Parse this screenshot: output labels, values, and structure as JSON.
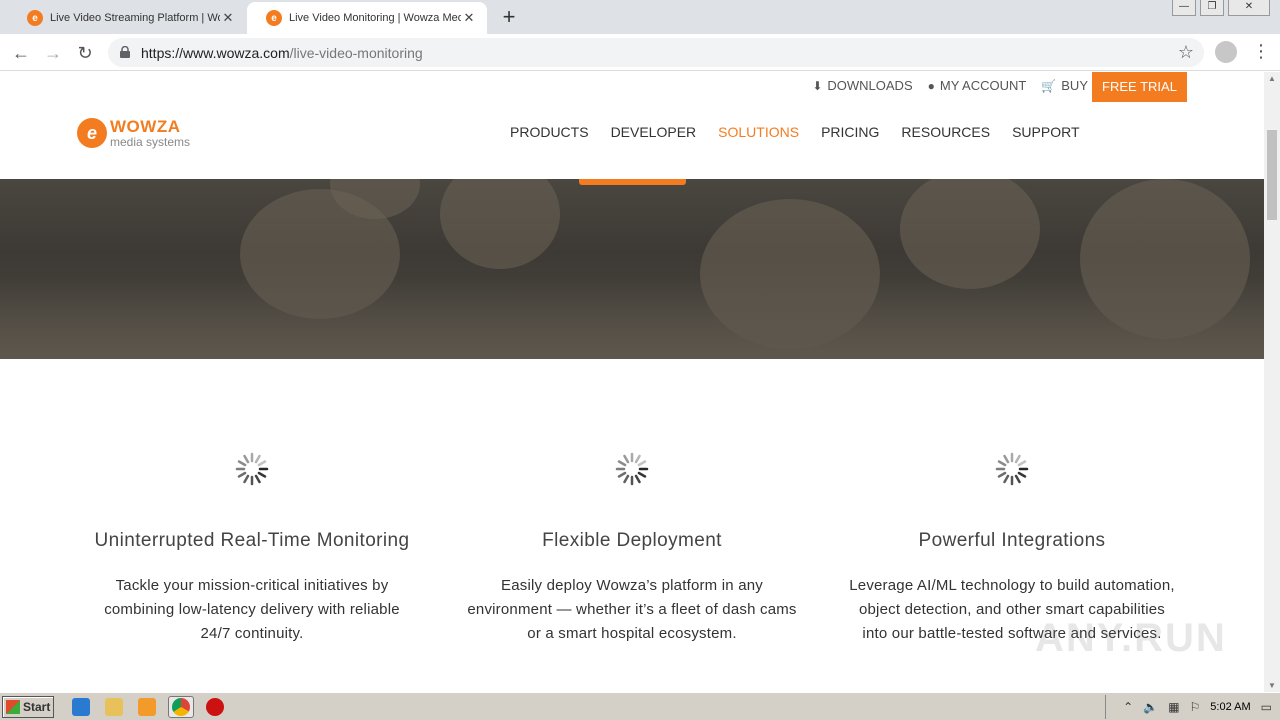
{
  "browser": {
    "tabs": [
      {
        "title": "Live Video Streaming Platform | Wow",
        "active": false
      },
      {
        "title": "Live Video Monitoring | Wowza Medi",
        "active": true
      }
    ],
    "new_tab_label": "+",
    "url_host": "https://www.wowza.com",
    "url_path": "/live-video-monitoring"
  },
  "site": {
    "utility_nav": {
      "downloads": "DOWNLOADS",
      "my_account": "MY ACCOUNT",
      "buy": "BUY",
      "free_trial": "FREE TRIAL"
    },
    "logo": {
      "brand": "WOWZA",
      "sub": "media systems"
    },
    "main_nav": [
      "PRODUCTS",
      "DEVELOPER",
      "SOLUTIONS",
      "PRICING",
      "RESOURCES",
      "SUPPORT"
    ],
    "active_nav": "SOLUTIONS",
    "accent_color": "#f47c20"
  },
  "features": [
    {
      "title": "Uninterrupted Real-Time Monitoring",
      "lines": [
        "Tackle your mission-critical initiatives by",
        "combining low-latency delivery with reliable",
        "24/7 continuity."
      ]
    },
    {
      "title": "Flexible Deployment",
      "lines": [
        "Easily deploy Wowza’s platform in any",
        "environment — whether it’s a fleet of dash cams",
        "or a smart hospital ecosystem."
      ]
    },
    {
      "title": "Powerful Integrations",
      "lines": [
        "Leverage AI/ML technology to build automation,",
        "object detection, and other smart capabilities",
        "into our battle-tested software and services."
      ]
    }
  ],
  "watermark": "ANY.RUN",
  "taskbar": {
    "start_label": "Start",
    "clock": "5:02 AM"
  }
}
